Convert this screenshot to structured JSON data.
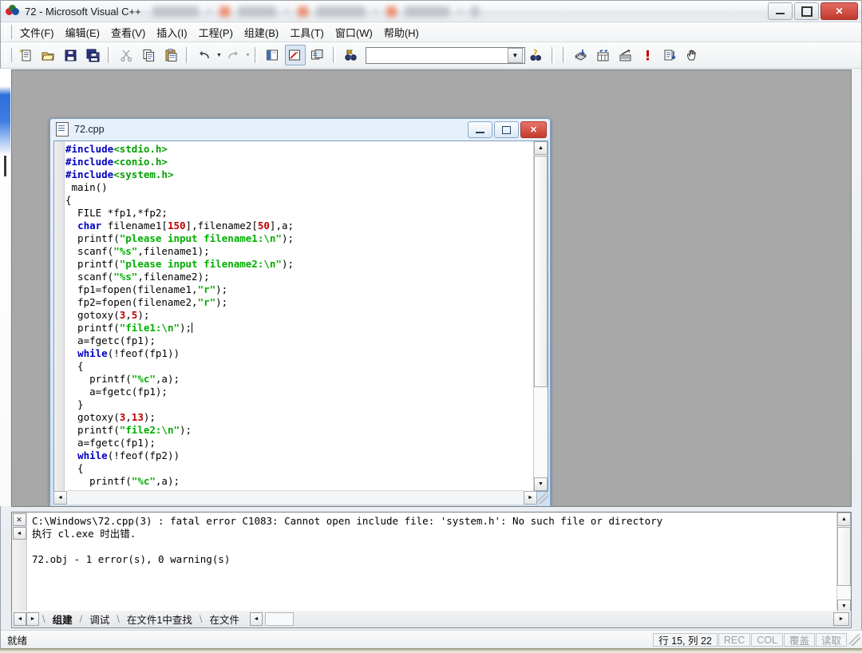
{
  "window": {
    "title": "72 - Microsoft Visual C++",
    "app_icon": "vcpp-icon",
    "minimize_label": "Minimize",
    "maximize_label": "Maximize",
    "close_label": "✕"
  },
  "menubar": {
    "items": [
      {
        "label": "文件(F)"
      },
      {
        "label": "编辑(E)"
      },
      {
        "label": "查看(V)"
      },
      {
        "label": "插入(I)"
      },
      {
        "label": "工程(P)"
      },
      {
        "label": "组建(B)"
      },
      {
        "label": "工具(T)"
      },
      {
        "label": "窗口(W)"
      },
      {
        "label": "帮助(H)"
      }
    ]
  },
  "toolbar": {
    "search_combo_value": "",
    "search_combo_placeholder": "",
    "dropdown_glyph": "▼",
    "buttons": [
      {
        "name": "new-text-file-button",
        "icon": "new-document-icon"
      },
      {
        "name": "open-button",
        "icon": "open-folder-icon"
      },
      {
        "name": "save-button",
        "icon": "floppy-disk-icon"
      },
      {
        "name": "save-all-button",
        "icon": "save-all-icon"
      },
      {
        "name": "cut-button",
        "icon": "scissors-icon"
      },
      {
        "name": "copy-button",
        "icon": "copy-icon"
      },
      {
        "name": "paste-button",
        "icon": "clipboard-paste-icon"
      },
      {
        "name": "undo-button",
        "icon": "undo-arrow-icon"
      },
      {
        "name": "redo-button",
        "icon": "redo-arrow-icon"
      },
      {
        "name": "workspace-button",
        "icon": "workspace-window-icon"
      },
      {
        "name": "output-window-button",
        "icon": "output-window-icon"
      },
      {
        "name": "window-list-button",
        "icon": "window-list-icon"
      },
      {
        "name": "find-in-files-button",
        "icon": "binoculars-flag-icon"
      },
      {
        "name": "find-button",
        "icon": "binoculars-icon"
      },
      {
        "name": "compile-button",
        "icon": "compile-icon"
      },
      {
        "name": "build-button",
        "icon": "build-bricks-icon"
      },
      {
        "name": "stop-build-button",
        "icon": "stop-build-icon"
      },
      {
        "name": "execute-button",
        "icon": "exclamation-run-icon"
      },
      {
        "name": "go-button",
        "icon": "go-step-icon"
      },
      {
        "name": "insert-breakpoint-button",
        "icon": "hand-icon"
      }
    ]
  },
  "editor_window": {
    "title": "72.cpp",
    "icon": "cpp-document-icon",
    "minimize_label": "Minimize",
    "maximize_label": "Maximize",
    "close_label": "✕",
    "code_lines": [
      [
        {
          "t": "#include",
          "c": "pre"
        },
        {
          "t": "<stdio.h>",
          "c": "hdr"
        }
      ],
      [
        {
          "t": "#include",
          "c": "pre"
        },
        {
          "t": "<conio.h>",
          "c": "hdr"
        }
      ],
      [
        {
          "t": "#include",
          "c": "pre"
        },
        {
          "t": "<system.h>",
          "c": "hdr"
        }
      ],
      [
        {
          "t": " main()",
          "c": ""
        }
      ],
      [
        {
          "t": "{",
          "c": ""
        }
      ],
      [
        {
          "t": "  FILE *fp1,*fp2;",
          "c": ""
        }
      ],
      [
        {
          "t": "  ",
          "c": ""
        },
        {
          "t": "char",
          "c": "kw"
        },
        {
          "t": " filename1[",
          "c": ""
        },
        {
          "t": "150",
          "c": "num"
        },
        {
          "t": "],filename2[",
          "c": ""
        },
        {
          "t": "50",
          "c": "num"
        },
        {
          "t": "],a;",
          "c": ""
        }
      ],
      [
        {
          "t": "  printf(",
          "c": ""
        },
        {
          "t": "\"please input filename1:\\n\"",
          "c": "str"
        },
        {
          "t": ");",
          "c": ""
        }
      ],
      [
        {
          "t": "  scanf(",
          "c": ""
        },
        {
          "t": "\"%s\"",
          "c": "str"
        },
        {
          "t": ",filename1);",
          "c": ""
        }
      ],
      [
        {
          "t": "  printf(",
          "c": ""
        },
        {
          "t": "\"please input filename2:\\n\"",
          "c": "str"
        },
        {
          "t": ");",
          "c": ""
        }
      ],
      [
        {
          "t": "  scanf(",
          "c": ""
        },
        {
          "t": "\"%s\"",
          "c": "str"
        },
        {
          "t": ",filename2);",
          "c": ""
        }
      ],
      [
        {
          "t": "  fp1=fopen(filename1,",
          "c": ""
        },
        {
          "t": "\"r\"",
          "c": "str"
        },
        {
          "t": ");",
          "c": ""
        }
      ],
      [
        {
          "t": "  fp2=fopen(filename2,",
          "c": ""
        },
        {
          "t": "\"r\"",
          "c": "str"
        },
        {
          "t": ");",
          "c": ""
        }
      ],
      [
        {
          "t": "  gotoxy(",
          "c": ""
        },
        {
          "t": "3",
          "c": "num"
        },
        {
          "t": ",",
          "c": ""
        },
        {
          "t": "5",
          "c": "num"
        },
        {
          "t": ");",
          "c": ""
        }
      ],
      [
        {
          "t": "  printf(",
          "c": ""
        },
        {
          "t": "\"file1:\\n\"",
          "c": "str"
        },
        {
          "t": ");",
          "c": ""
        },
        {
          "t": "|CARET|",
          "c": "caret"
        }
      ],
      [
        {
          "t": "  a=fgetc(fp1);",
          "c": ""
        }
      ],
      [
        {
          "t": "  ",
          "c": ""
        },
        {
          "t": "while",
          "c": "kw"
        },
        {
          "t": "(!feof(fp1))",
          "c": ""
        }
      ],
      [
        {
          "t": "  {",
          "c": ""
        }
      ],
      [
        {
          "t": "    printf(",
          "c": ""
        },
        {
          "t": "\"%c\"",
          "c": "str"
        },
        {
          "t": ",a);",
          "c": ""
        }
      ],
      [
        {
          "t": "    a=fgetc(fp1);",
          "c": ""
        }
      ],
      [
        {
          "t": "  }",
          "c": ""
        }
      ],
      [
        {
          "t": "  gotoxy(",
          "c": ""
        },
        {
          "t": "3",
          "c": "num"
        },
        {
          "t": ",",
          "c": ""
        },
        {
          "t": "13",
          "c": "num"
        },
        {
          "t": ");",
          "c": ""
        }
      ],
      [
        {
          "t": "  printf(",
          "c": ""
        },
        {
          "t": "\"file2:\\n\"",
          "c": "str"
        },
        {
          "t": ");",
          "c": ""
        }
      ],
      [
        {
          "t": "  a=fgetc(fp1);",
          "c": ""
        }
      ],
      [
        {
          "t": "  ",
          "c": ""
        },
        {
          "t": "while",
          "c": "kw"
        },
        {
          "t": "(!feof(fp2))",
          "c": ""
        }
      ],
      [
        {
          "t": "  {",
          "c": ""
        }
      ],
      [
        {
          "t": "    printf(",
          "c": ""
        },
        {
          "t": "\"%c\"",
          "c": "str"
        },
        {
          "t": ",a);",
          "c": ""
        }
      ]
    ]
  },
  "output_pane": {
    "close_label": "✕",
    "scroll_up_glyph": "◄",
    "text": "C:\\Windows\\72.cpp(3) : fatal error C1083: Cannot open include file: 'system.h': No such file or directory\n执行 cl.exe 时出错.\n\n72.obj - 1 error(s), 0 warning(s)"
  },
  "tabstrip": {
    "prev_glyph": "◄",
    "next_glyph": "►",
    "scroll_glyph": "◄",
    "tabs": [
      {
        "label": "组建",
        "active": true
      },
      {
        "label": "调试",
        "active": false
      },
      {
        "label": "在文件1中查找",
        "active": false
      },
      {
        "label": "在文件",
        "active": false
      }
    ]
  },
  "statusbar": {
    "message": "就绪",
    "line_col": "行 15, 列 22",
    "rec": "REC",
    "col": "COL",
    "ovr": "覆盖",
    "read": "读取"
  },
  "colors": {
    "keyword": "#0000c0",
    "string": "#00b000",
    "number": "#c00000",
    "header": "#00a000",
    "accent_blue": "#3f7ee3",
    "close_red": "#c0392b"
  }
}
